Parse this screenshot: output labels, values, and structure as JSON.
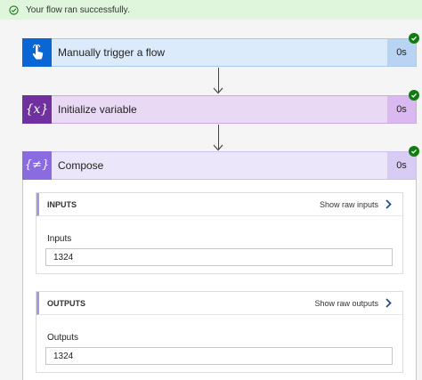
{
  "banner": {
    "message": "Your flow ran successfully.",
    "icon": "check-circle-icon"
  },
  "steps": [
    {
      "title": "Manually trigger a flow",
      "duration": "0s",
      "icon": "touch-hand-icon",
      "accent": "#0a66d4",
      "bg": "#dcebfb",
      "border": "#a9c8ee"
    },
    {
      "title": "Initialize variable",
      "duration": "0s",
      "icon": "variable-icon",
      "icon_text": "{x}",
      "accent": "#7030a0",
      "bg": "#e9d9f4",
      "border": "#c8a9e0"
    },
    {
      "title": "Compose",
      "duration": "0s",
      "icon": "compose-icon",
      "icon_text": "{≠}",
      "accent": "#8a6be0",
      "bg": "#ebe6f9",
      "border": "#cbbef0"
    }
  ],
  "compose": {
    "inputs": {
      "header": "INPUTS",
      "raw_label": "Show raw inputs",
      "field_label": "Inputs",
      "value": "1324"
    },
    "outputs": {
      "header": "OUTPUTS",
      "raw_label": "Show raw outputs",
      "field_label": "Outputs",
      "value": "1324"
    }
  },
  "status_color": "#107c10"
}
